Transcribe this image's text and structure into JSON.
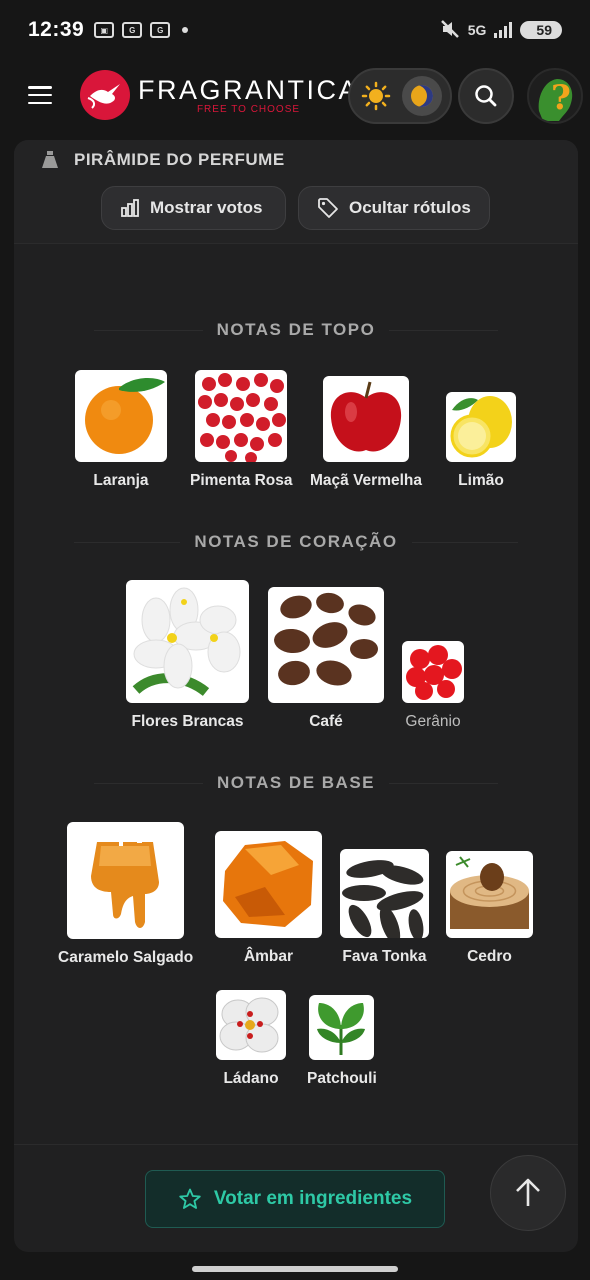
{
  "status_bar": {
    "time": "12:39",
    "left_icons": [
      "screenshot-icon",
      "g-icon",
      "g-icon"
    ],
    "network": "5G",
    "battery": "59"
  },
  "header": {
    "logo_name": "FRAGRANTICA",
    "logo_tagline": "FREE TO CHOOSE",
    "icons": [
      "menu-icon",
      "sun-icon",
      "moon-icon",
      "search-icon",
      "help-icon"
    ]
  },
  "pyramid": {
    "title": "PIRÂMIDE DO PERFUME",
    "show_votes_label": "Mostrar votos",
    "hide_labels_label": "Ocultar rótulos"
  },
  "sections": {
    "top": {
      "heading": "NOTAS DE TOPO",
      "notes": [
        {
          "label": "Laranja",
          "icon": "orange"
        },
        {
          "label": "Pimenta Rosa",
          "icon": "pink-pepper"
        },
        {
          "label": "Maçã Vermelha",
          "icon": "red-apple"
        },
        {
          "label": "Limão",
          "icon": "lemon"
        }
      ]
    },
    "heart": {
      "heading": "NOTAS DE CORAÇÃO",
      "notes": [
        {
          "label": "Flores Brancas",
          "icon": "white-flowers"
        },
        {
          "label": "Café",
          "icon": "coffee-beans"
        },
        {
          "label": "Gerânio",
          "icon": "geranium"
        }
      ]
    },
    "base": {
      "heading": "NOTAS DE BASE",
      "notes": [
        {
          "label": "Caramelo Salgado",
          "icon": "salted-caramel"
        },
        {
          "label": "Âmbar",
          "icon": "amber"
        },
        {
          "label": "Fava Tonka",
          "icon": "tonka-bean"
        },
        {
          "label": "Cedro",
          "icon": "cedar"
        },
        {
          "label": "Ládano",
          "icon": "labdanum"
        },
        {
          "label": "Patchouli",
          "icon": "patchouli"
        }
      ]
    }
  },
  "footer": {
    "vote_label": "Votar em ingredientes"
  },
  "colors": {
    "accent_red": "#d9163a",
    "vote_green": "#2ec9a6",
    "background": "#161616",
    "card": "#202021"
  }
}
